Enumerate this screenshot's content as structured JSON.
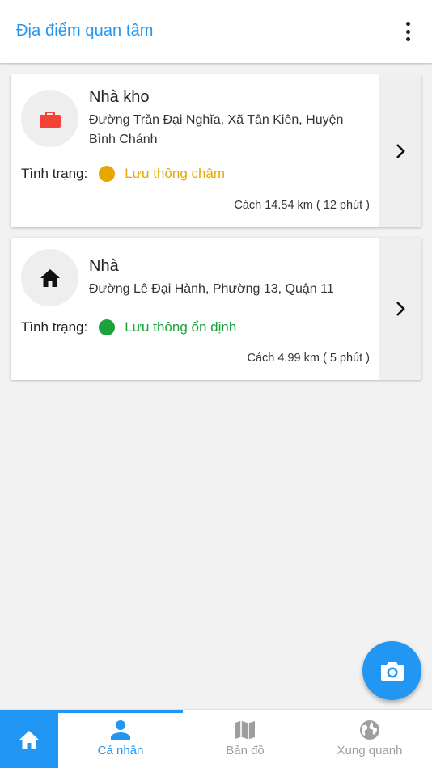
{
  "header": {
    "title": "Địa điểm quan tâm"
  },
  "places": [
    {
      "name": "Nhà kho",
      "address": "Đường Trần Đại Nghĩa, Xã Tân Kiên, Huyện Bình Chánh",
      "status_label": "Tình trạng:",
      "status": "Lưu thông chậm",
      "status_color": "#e6a800",
      "distance": "Cách 14.54 km ( 12 phút )",
      "icon": "briefcase-icon",
      "icon_color": "#f44336"
    },
    {
      "name": "Nhà",
      "address": "Đường Lê Đại Hành, Phường 13, Quận 11",
      "status_label": "Tình trạng:",
      "status": "Lưu thông ổn định",
      "status_color": "#1aa33a",
      "distance": "Cách 4.99 km ( 5 phút )",
      "icon": "home-icon",
      "icon_color": "#111111"
    }
  ],
  "nav": {
    "home_icon": "home-icon",
    "tabs": [
      {
        "label": "Cá nhân",
        "icon": "person-icon",
        "active": true
      },
      {
        "label": "Bản đồ",
        "icon": "map-icon",
        "active": false
      },
      {
        "label": "Xung quanh",
        "icon": "globe-icon",
        "active": false
      }
    ]
  },
  "fab": {
    "icon": "camera-icon"
  },
  "colors": {
    "accent": "#2196f3",
    "inactive": "#9e9e9e"
  }
}
